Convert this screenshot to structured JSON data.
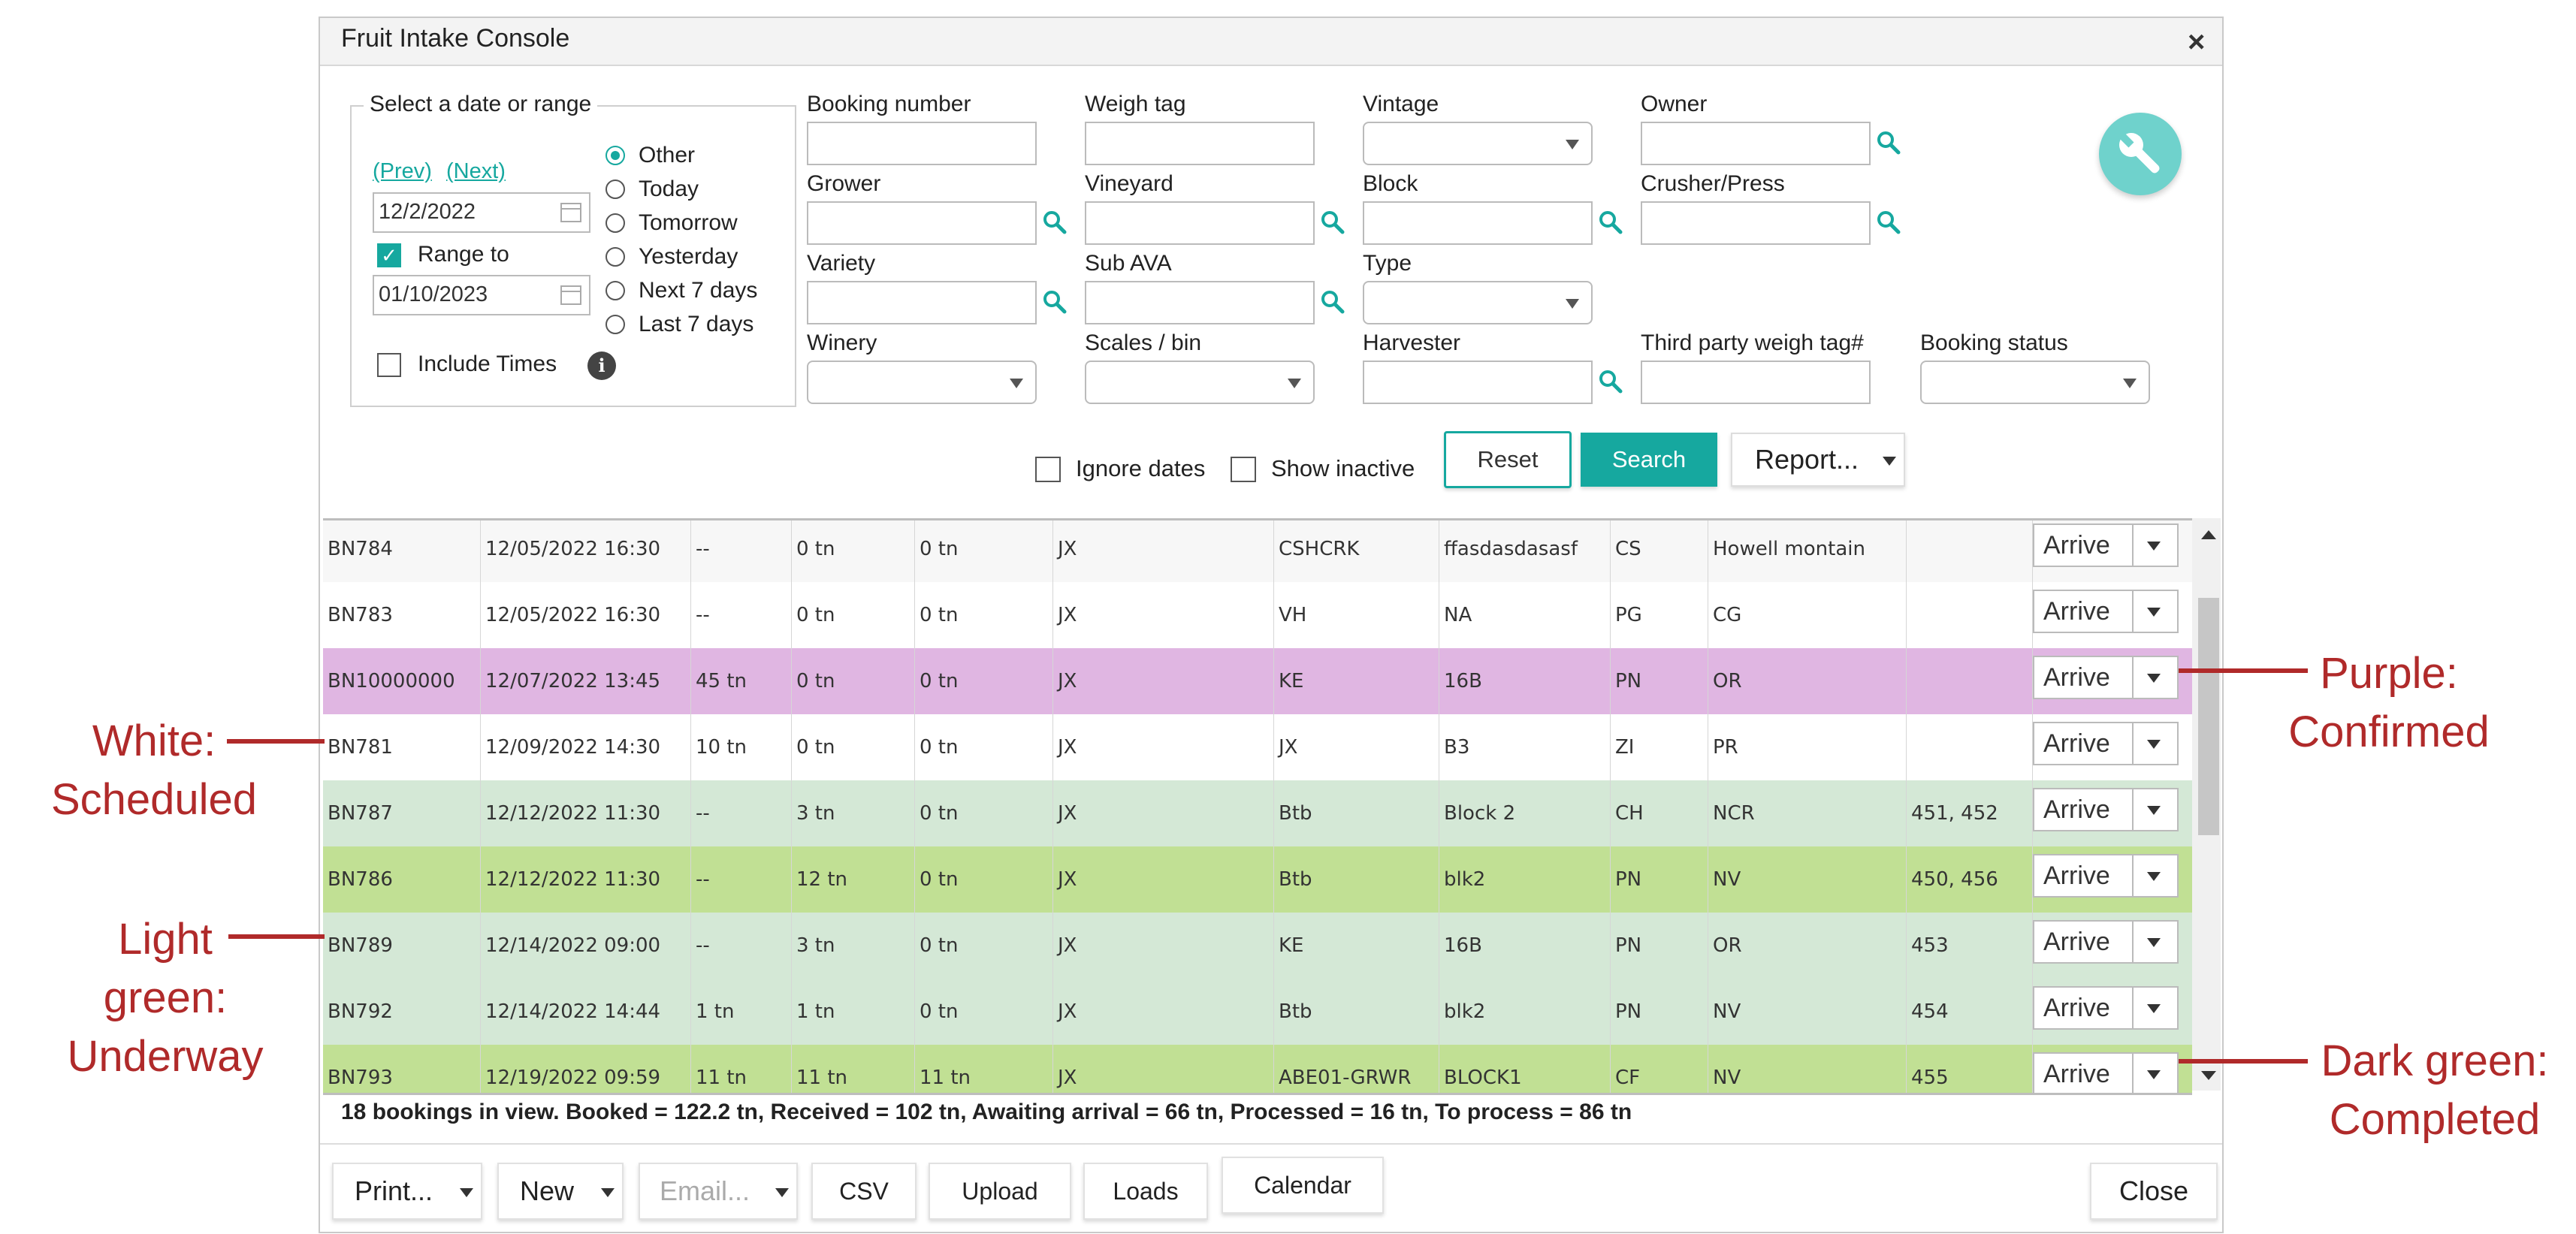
{
  "window": {
    "title": "Fruit Intake Console",
    "close_glyph": "×"
  },
  "date_panel": {
    "legend": "Select a date or range",
    "prev": "(Prev)",
    "next": "(Next)",
    "start_date": "12/2/2022",
    "range_to_label": "Range to",
    "range_to_checked": true,
    "end_date": "01/10/2023",
    "include_times_label": "Include Times",
    "include_times_checked": false,
    "info_glyph": "i",
    "radios": [
      {
        "label": "Other",
        "selected": true
      },
      {
        "label": "Today",
        "selected": false
      },
      {
        "label": "Tomorrow",
        "selected": false
      },
      {
        "label": "Yesterday",
        "selected": false
      },
      {
        "label": "Next 7 days",
        "selected": false
      },
      {
        "label": "Last 7 days",
        "selected": false
      }
    ]
  },
  "filters": {
    "booking_number": "Booking number",
    "weigh_tag": "Weigh tag",
    "vintage": "Vintage",
    "owner": "Owner",
    "grower": "Grower",
    "vineyard": "Vineyard",
    "block": "Block",
    "crusher_press": "Crusher/Press",
    "variety": "Variety",
    "sub_ava": "Sub AVA",
    "type": "Type",
    "winery": "Winery",
    "scales_bin": "Scales / bin",
    "harvester": "Harvester",
    "third_party": "Third party weigh tag#",
    "booking_status": "Booking status"
  },
  "actions": {
    "ignore_dates": "Ignore dates",
    "show_inactive": "Show inactive",
    "reset": "Reset",
    "search": "Search",
    "report": "Report..."
  },
  "rows": [
    {
      "id": "BN784",
      "date": "12/05/2022 16:30",
      "booked": "--",
      "received": "0 tn",
      "processed": "0 tn",
      "c6": "JX",
      "c7": "CSHCRK",
      "c8": "ffasdasdasasf",
      "c9": "CS",
      "c10": "Howell montain",
      "c11": "",
      "action": "Arrive",
      "bg": "#f7f7f7"
    },
    {
      "id": "BN783",
      "date": "12/05/2022 16:30",
      "booked": "--",
      "received": "0 tn",
      "processed": "0 tn",
      "c6": "JX",
      "c7": "VH",
      "c8": "NA",
      "c9": "PG",
      "c10": "CG",
      "c11": "",
      "action": "Arrive",
      "bg": "#ffffff"
    },
    {
      "id": "BN10000000",
      "date": "12/07/2022 13:45",
      "booked": "45 tn",
      "received": "0 tn",
      "processed": "0 tn",
      "c6": "JX",
      "c7": "KE",
      "c8": "16B",
      "c9": "PN",
      "c10": "OR",
      "c11": "",
      "action": "Arrive",
      "bg": "#e0b6e2"
    },
    {
      "id": "BN781",
      "date": "12/09/2022 14:30",
      "booked": "10 tn",
      "received": "0 tn",
      "processed": "0 tn",
      "c6": "JX",
      "c7": "JX",
      "c8": "B3",
      "c9": "ZI",
      "c10": "PR",
      "c11": "",
      "action": "Arrive",
      "bg": "#ffffff"
    },
    {
      "id": "BN787",
      "date": "12/12/2022 11:30",
      "booked": "--",
      "received": "3 tn",
      "processed": "0 tn",
      "c6": "JX",
      "c7": "Btb",
      "c8": "Block 2",
      "c9": "CH",
      "c10": "NCR",
      "c11": "451, 452",
      "action": "Arrive",
      "bg": "#d4e8d6"
    },
    {
      "id": "BN786",
      "date": "12/12/2022 11:30",
      "booked": "--",
      "received": "12 tn",
      "processed": "0 tn",
      "c6": "JX",
      "c7": "Btb",
      "c8": "blk2",
      "c9": "PN",
      "c10": "NV",
      "c11": "450, 456",
      "action": "Arrive",
      "bg": "#c1e094"
    },
    {
      "id": "BN789",
      "date": "12/14/2022 09:00",
      "booked": "--",
      "received": "3 tn",
      "processed": "0 tn",
      "c6": "JX",
      "c7": "KE",
      "c8": "16B",
      "c9": "PN",
      "c10": "OR",
      "c11": "453",
      "action": "Arrive",
      "bg": "#d4e8d6"
    },
    {
      "id": "BN792",
      "date": "12/14/2022 14:44",
      "booked": "1 tn",
      "received": "1 tn",
      "processed": "0 tn",
      "c6": "JX",
      "c7": "Btb",
      "c8": "blk2",
      "c9": "PN",
      "c10": "NV",
      "c11": "454",
      "action": "Arrive",
      "bg": "#d4e8d6"
    },
    {
      "id": "BN793",
      "date": "12/19/2022 09:59",
      "booked": "11 tn",
      "received": "11 tn",
      "processed": "11 tn",
      "c6": "JX",
      "c7": "ABE01-GRWR",
      "c8": "BLOCK1",
      "c9": "CF",
      "c10": "NV",
      "c11": "455",
      "action": "Arrive",
      "bg": "#c1e094"
    }
  ],
  "summary": "18 bookings in view. Booked = 122.2 tn, Received = 102 tn, Awaiting arrival = 66 tn, Processed = 16 tn, To process = 86 tn",
  "footer": {
    "print": "Print...",
    "new": "New",
    "email": "Email...",
    "csv": "CSV",
    "upload": "Upload",
    "loads": "Loads",
    "calendar": "Calendar",
    "close": "Close"
  },
  "annotations": {
    "white": [
      "White:",
      "Scheduled"
    ],
    "light_green": [
      "Light",
      "green:",
      "Underway"
    ],
    "purple": [
      "Purple:",
      "Confirmed"
    ],
    "dark_green": [
      "Dark green:",
      "Completed"
    ]
  },
  "colors": {
    "accent": "#16a89f",
    "purple_row": "#e0b6e2",
    "light_green_row": "#d4e8d6",
    "dark_green_row": "#c1e094",
    "annotation": "#b02a2a"
  },
  "icons": [
    "close-icon",
    "calendar-icon",
    "info-icon",
    "search-icon",
    "wrench-icon",
    "chevron-down-icon",
    "scroll-up-icon",
    "scroll-down-icon"
  ]
}
